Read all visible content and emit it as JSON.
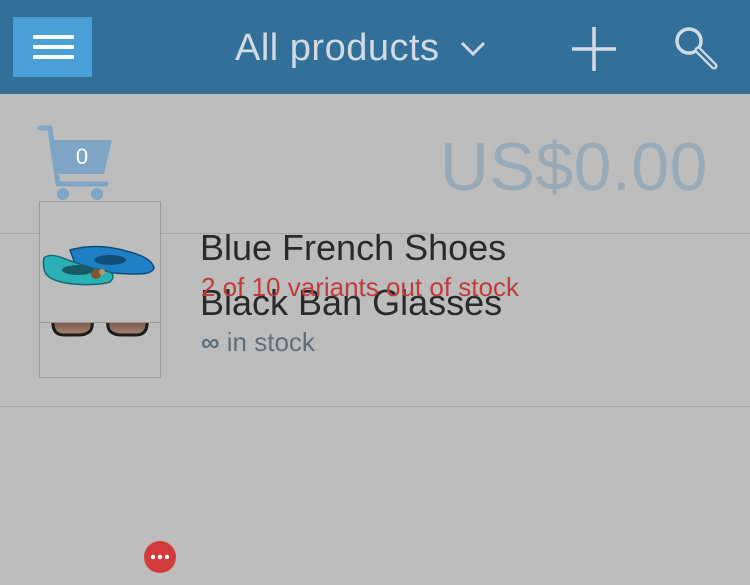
{
  "header": {
    "title": "All products",
    "menu_icon": "hamburger-menu-icon",
    "dropdown_icon": "chevron-down-icon",
    "add_icon": "plus-icon",
    "search_icon": "search-icon",
    "bar_color": "#32709a",
    "menu_color": "#4a9fd6"
  },
  "cart": {
    "count": "0",
    "total": "US$0.00",
    "icon": "shopping-cart-icon"
  },
  "products": [
    {
      "name": "Black Ban Glasses",
      "stock_symbol": "∞",
      "stock_text": " in stock",
      "image_icon": "sunglasses-icon"
    },
    {
      "name": "Blue French Shoes",
      "stock_text": "2 of 10 variants out of stock",
      "image_icon": "shoes-icon",
      "badge_icon": "more-options-icon",
      "warning_color": "#c23b3b"
    }
  ]
}
